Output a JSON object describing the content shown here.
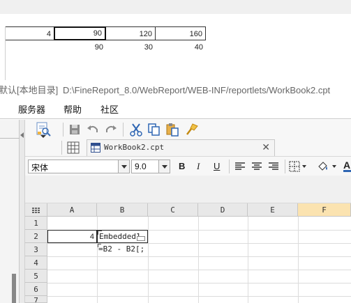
{
  "background_table": {
    "row1": [
      "4",
      "90",
      "120",
      "160"
    ],
    "row2": [
      "90",
      "30",
      "40"
    ]
  },
  "window": {
    "title_prefix": "默认[本地目录]",
    "title_path": "D:\\FineReport_8.0/WebReport/WEB-INF/reportlets/WorkBook2.cpt"
  },
  "menu": {
    "items": [
      "服务器",
      "帮助",
      "社区"
    ]
  },
  "toolbar": {
    "icons": [
      "template-preview-icon",
      "save-icon",
      "undo-icon",
      "redo-icon",
      "cut-icon",
      "copy-icon",
      "paste-icon",
      "format-painter-icon"
    ]
  },
  "tab": {
    "label": "WorkBook2.cpt",
    "close": "✕"
  },
  "format": {
    "font_name": "宋体",
    "font_size": "9.0",
    "bold": "B",
    "italic": "I",
    "underline": "U"
  },
  "grid": {
    "columns": [
      "A",
      "B",
      "C",
      "D",
      "E",
      "F"
    ],
    "rows": [
      "1",
      "2",
      "3",
      "4",
      "5",
      "6",
      "7"
    ],
    "active_column": "F",
    "cells": {
      "A2": "4",
      "B2": "Embedded1",
      "B3": "=B2 - B2[;"
    }
  },
  "colors": {
    "active_column_header": "#fbe3b0",
    "header_bg": "#e8e8e8"
  }
}
